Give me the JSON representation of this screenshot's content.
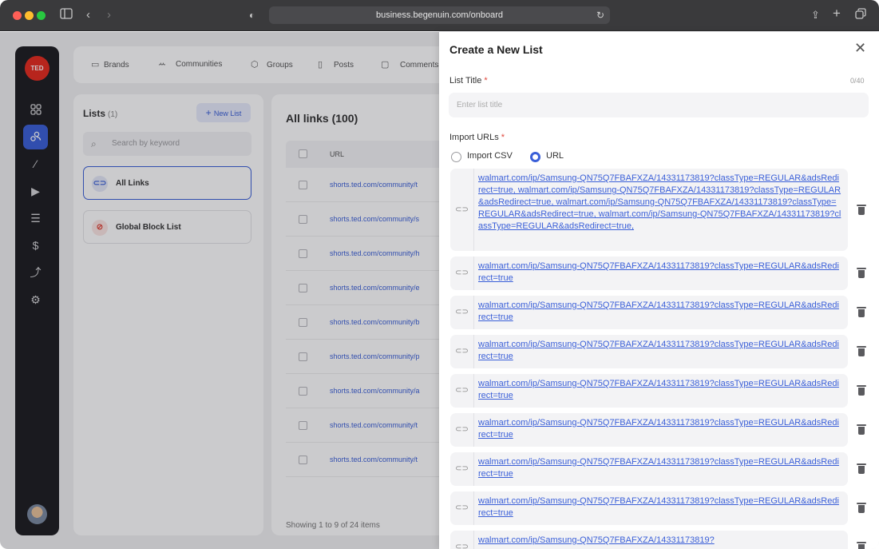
{
  "browser": {
    "url": "business.begenuin.com/onboard"
  },
  "sidebar": {
    "logo": "TED",
    "icons": [
      "grid-icon",
      "people-icon",
      "magic-wand-icon",
      "video-play-icon",
      "checklist-icon",
      "dollar-icon",
      "analytics-icon",
      "settings-icon"
    ]
  },
  "topnav": {
    "items": [
      "Brands",
      "Communities",
      "Groups",
      "Posts",
      "Comments"
    ]
  },
  "lists": {
    "title": "Lists",
    "count": "(1)",
    "new_list": "New List",
    "search_placeholder": "Search by keyword",
    "cards": [
      "All Links",
      "Global Block List"
    ]
  },
  "links_table": {
    "title": "All links (100)",
    "column": "URL",
    "rows": [
      "shorts.ted.com/community/t",
      "shorts.ted.com/community/s",
      "shorts.ted.com/community/h",
      "shorts.ted.com/community/e",
      "shorts.ted.com/community/b",
      "shorts.ted.com/community/p",
      "shorts.ted.com/community/a",
      "shorts.ted.com/community/t",
      "shorts.ted.com/community/t"
    ],
    "showing": "Showing 1 to 9 of 24 items"
  },
  "modal": {
    "title": "Create a New List",
    "list_title_label": "List Title",
    "required_mark": "*",
    "counter": "0/40",
    "title_placeholder": "Enter list title",
    "import_label": "Import URLs",
    "option_csv": "Import CSV",
    "option_url": "URL",
    "selected_option": "URL",
    "urls": [
      "walmart.com/ip/Samsung-QN75Q7FBAFXZA/14331173819?classType=REGULAR&adsRedirect=true, walmart.com/ip/Samsung-QN75Q7FBAFXZA/14331173819?classType=REGULAR&adsRedirect=true, walmart.com/ip/Samsung-QN75Q7FBAFXZA/14331173819?classType=REGULAR&adsRedirect=true, walmart.com/ip/Samsung-QN75Q7FBAFXZA/14331173819?classType=REGULAR&adsRedirect=true,",
      "walmart.com/ip/Samsung-QN75Q7FBAFXZA/14331173819?classType=REGULAR&adsRedirect=true",
      "walmart.com/ip/Samsung-QN75Q7FBAFXZA/14331173819?classType=REGULAR&adsRedirect=true",
      "walmart.com/ip/Samsung-QN75Q7FBAFXZA/14331173819?classType=REGULAR&adsRedirect=true",
      "walmart.com/ip/Samsung-QN75Q7FBAFXZA/14331173819?classType=REGULAR&adsRedirect=true",
      "walmart.com/ip/Samsung-QN75Q7FBAFXZA/14331173819?classType=REGULAR&adsRedirect=true",
      "walmart.com/ip/Samsung-QN75Q7FBAFXZA/14331173819?classType=REGULAR&adsRedirect=true",
      "walmart.com/ip/Samsung-QN75Q7FBAFXZA/14331173819?classType=REGULAR&adsRedirect=true",
      "walmart.com/ip/Samsung-QN75Q7FBAFXZA/14331173819?"
    ]
  },
  "colors": {
    "accent": "#3a5fd8",
    "danger": "#e0463a",
    "ted_red": "#e62b1e"
  }
}
